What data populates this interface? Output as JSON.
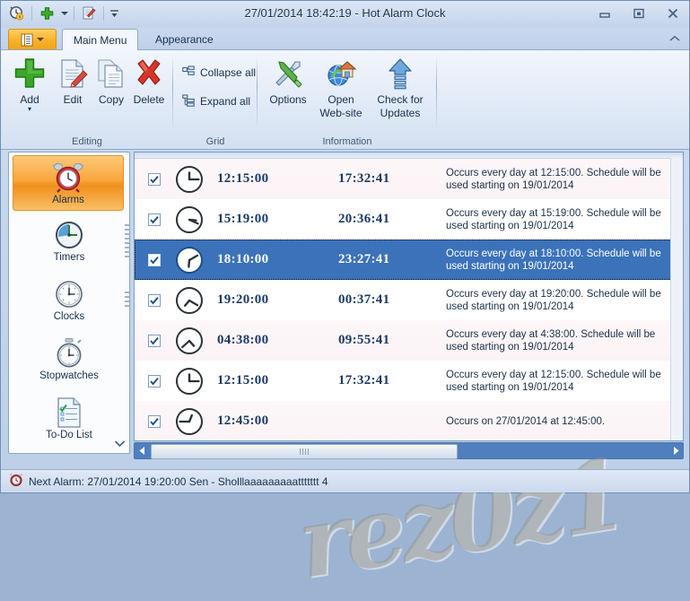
{
  "window": {
    "title": "27/01/2014 18:42:19 - Hot Alarm Clock",
    "minimize_label": "Minimize",
    "restore_label": "Restore",
    "close_label": "Close"
  },
  "quick_access": {
    "items": [
      {
        "name": "alarm-clock-icon",
        "label": "Hot Alarm Clock"
      },
      {
        "name": "add-icon",
        "label": "Add"
      },
      {
        "name": "add-dropdown-icon",
        "label": "Add options"
      },
      {
        "name": "edit-icon",
        "label": "Edit"
      },
      {
        "name": "customize-qat-icon",
        "label": "Customize Quick Access Toolbar"
      }
    ]
  },
  "tabs": {
    "app_button_label": "Application Menu",
    "items": [
      {
        "label": "Main Menu",
        "active": true
      },
      {
        "label": "Appearance",
        "active": false
      }
    ],
    "collapse_ribbon_label": "Minimize the Ribbon"
  },
  "ribbon": {
    "groups": [
      {
        "title": "Editing",
        "buttons": [
          {
            "label": "Add",
            "icon": "plus-icon",
            "has_dropdown": true
          },
          {
            "label": "Edit",
            "icon": "edit-document-icon",
            "has_dropdown": false
          },
          {
            "label": "Copy",
            "icon": "copy-icon",
            "has_dropdown": false
          },
          {
            "label": "Delete",
            "icon": "delete-x-icon",
            "has_dropdown": false
          }
        ]
      },
      {
        "title": "Grid",
        "small_buttons": [
          {
            "label": "Collapse all",
            "icon": "collapse-all-icon"
          },
          {
            "label": "Expand all",
            "icon": "expand-all-icon"
          }
        ]
      },
      {
        "title": "Information",
        "buttons": [
          {
            "label": "Options",
            "icon": "tools-icon",
            "has_dropdown": false
          },
          {
            "label": "Open\nWeb-site",
            "label_line1": "Open",
            "label_line2": "Web-site",
            "icon": "globe-home-icon",
            "has_dropdown": false
          },
          {
            "label_line1": "Check for",
            "label_line2": "Updates",
            "icon": "update-arrow-icon",
            "has_dropdown": false
          }
        ]
      }
    ]
  },
  "sidebar": {
    "items": [
      {
        "label": "Alarms",
        "icon": "alarm-clock-icon",
        "selected": true
      },
      {
        "label": "Timers",
        "icon": "timer-icon",
        "selected": false
      },
      {
        "label": "Clocks",
        "icon": "clock-icon",
        "selected": false
      },
      {
        "label": "Stopwatches",
        "icon": "stopwatch-icon",
        "selected": false
      },
      {
        "label": "To-Do List",
        "icon": "todo-list-icon",
        "selected": false
      },
      {
        "label": "",
        "icon": "birthday-cake-icon",
        "selected": false
      }
    ],
    "scroll_down_label": "Scroll down"
  },
  "grid": {
    "rows": [
      {
        "enabled": true,
        "clock_icon": "clock-1215-icon",
        "clock_hour_deg": 0,
        "clock_minute_deg": 90,
        "time": "12:15:00",
        "next": "17:32:41",
        "description": "Occurs every day at 12:15:00. Schedule will be used starting on 19/01/2014",
        "selected": false
      },
      {
        "enabled": true,
        "clock_icon": "clock-1519-icon",
        "clock_hour_deg": 95,
        "clock_minute_deg": 114,
        "time": "15:19:00",
        "next": "20:36:41",
        "description": "Occurs every day at 15:19:00. Schedule will be used starting on 19/01/2014",
        "selected": false
      },
      {
        "enabled": true,
        "clock_icon": "clock-1810-icon",
        "clock_hour_deg": 185,
        "clock_minute_deg": 60,
        "time": "18:10:00",
        "next": "23:27:41",
        "description": "Occurs every day at 18:10:00. Schedule will be used starting on 19/01/2014",
        "selected": true
      },
      {
        "enabled": true,
        "clock_icon": "clock-1920-icon",
        "clock_hour_deg": 220,
        "clock_minute_deg": 120,
        "time": "19:20:00",
        "next": "00:37:41",
        "description": "Occurs every day at 19:20:00. Schedule will be used starting on 19/01/2014",
        "selected": false
      },
      {
        "enabled": true,
        "clock_icon": "clock-0438-icon",
        "clock_hour_deg": 138,
        "clock_minute_deg": 228,
        "time": "04:38:00",
        "next": "09:55:41",
        "description": "Occurs every day at 4:38:00. Schedule will be used starting on 19/01/2014",
        "selected": false
      },
      {
        "enabled": true,
        "clock_icon": "clock-1215-b-icon",
        "clock_hour_deg": 0,
        "clock_minute_deg": 90,
        "time": "12:15:00",
        "next": "17:32:41",
        "description": "Occurs every day at 12:15:00. Schedule will be used starting on 19/01/2014",
        "selected": false
      },
      {
        "enabled": true,
        "clock_icon": "clock-1245-icon",
        "clock_hour_deg": 22,
        "clock_minute_deg": 270,
        "time": "12:45:00",
        "next": "",
        "description": "Occurs on 27/01/2014 at 12:45:00.",
        "selected": false
      }
    ],
    "hscroll": {
      "left_arrow": "◄",
      "right_arrow": "►"
    }
  },
  "statusbar": {
    "icon": "alarm-clock-icon",
    "text": "Next Alarm: 27/01/2014 19:20:00 Sen - Sholllaaaaaaaaattttttt 4"
  },
  "watermark": {
    "text": "rez0z1"
  },
  "colors": {
    "selection_blue": "#3b72ba",
    "accent_orange": "#f0a518",
    "scrollbar_blue": "#4f7fbd",
    "text_dark": "#17304f"
  }
}
